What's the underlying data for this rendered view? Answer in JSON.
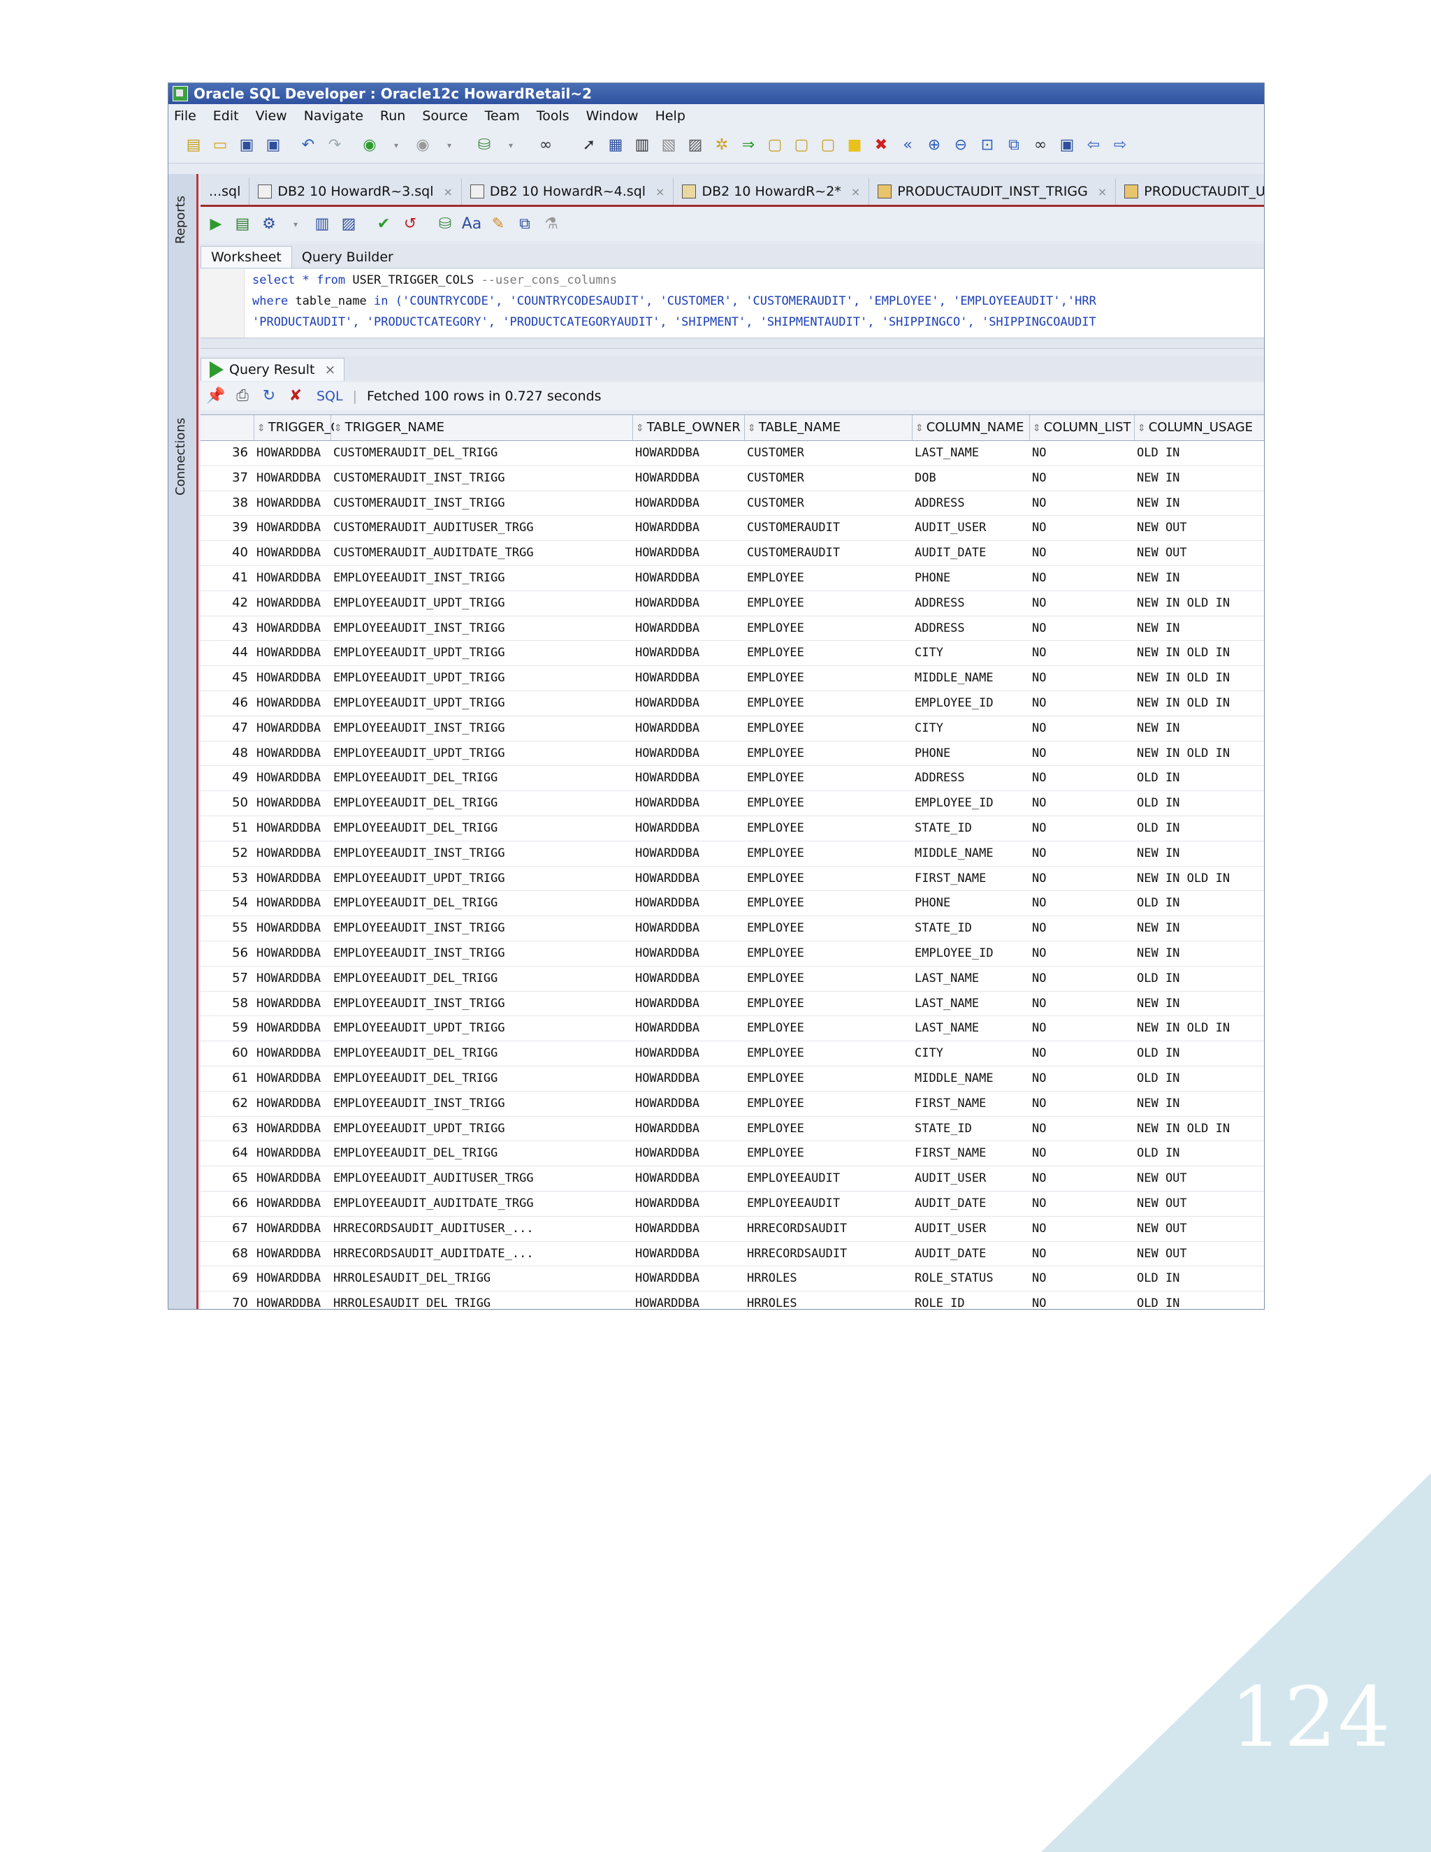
{
  "window": {
    "title": "Oracle SQL Developer : Oracle12c HowardRetail~2"
  },
  "menu": [
    "File",
    "Edit",
    "View",
    "Navigate",
    "Run",
    "Source",
    "Team",
    "Tools",
    "Window",
    "Help"
  ],
  "side_panels": [
    "Reports",
    "Connections"
  ],
  "doc_tabs": [
    {
      "label": "...sql"
    },
    {
      "label": "DB2 10 HowardR~3.sql"
    },
    {
      "label": "DB2 10 HowardR~4.sql"
    },
    {
      "label": "DB2 10 HowardR~2*"
    },
    {
      "label": "PRODUCTAUDIT_INST_TRIGG"
    },
    {
      "label": "PRODUCTAUDIT_UPDT_TRIGG"
    }
  ],
  "subtabs": {
    "worksheet": "Worksheet",
    "query_builder": "Query Builder"
  },
  "editor": {
    "line1_kw": "select * from",
    "line1_obj": "USER_TRIGGER_COLS",
    "line1_comment": "--user_cons_columns",
    "line2_kw": "where",
    "line2_plain": "table_name",
    "line2_kw2": "in",
    "line2_values": "('COUNTRYCODE', 'COUNTRYCODESAUDIT', 'CUSTOMER', 'CUSTOMERAUDIT', 'EMPLOYEE', 'EMPLOYEEAUDIT','HRR",
    "line3_values": "'PRODUCTAUDIT', 'PRODUCTCATEGORY', 'PRODUCTCATEGORYAUDIT', 'SHIPMENT', 'SHIPMENTAUDIT', 'SHIPPINGCO', 'SHIPPINGCOAUDIT"
  },
  "results": {
    "tab_label": "Query Result",
    "close": "×",
    "sql_link": "SQL",
    "status": "Fetched 100 rows in 0.727 seconds",
    "columns": [
      "TRIGGER_OWNER",
      "TRIGGER_NAME",
      "TABLE_OWNER",
      "TABLE_NAME",
      "COLUMN_NAME",
      "COLUMN_LIST",
      "COLUMN_USAGE"
    ],
    "rows": [
      [
        "36",
        "HOWARDDBA",
        "CUSTOMERAUDIT_DEL_TRIGG",
        "HOWARDDBA",
        "CUSTOMER",
        "LAST_NAME",
        "NO",
        "OLD IN"
      ],
      [
        "37",
        "HOWARDDBA",
        "CUSTOMERAUDIT_INST_TRIGG",
        "HOWARDDBA",
        "CUSTOMER",
        "DOB",
        "NO",
        "NEW IN"
      ],
      [
        "38",
        "HOWARDDBA",
        "CUSTOMERAUDIT_INST_TRIGG",
        "HOWARDDBA",
        "CUSTOMER",
        "ADDRESS",
        "NO",
        "NEW IN"
      ],
      [
        "39",
        "HOWARDDBA",
        "CUSTOMERAUDIT_AUDITUSER_TRGG",
        "HOWARDDBA",
        "CUSTOMERAUDIT",
        "AUDIT_USER",
        "NO",
        "NEW OUT"
      ],
      [
        "40",
        "HOWARDDBA",
        "CUSTOMERAUDIT_AUDITDATE_TRGG",
        "HOWARDDBA",
        "CUSTOMERAUDIT",
        "AUDIT_DATE",
        "NO",
        "NEW OUT"
      ],
      [
        "41",
        "HOWARDDBA",
        "EMPLOYEEAUDIT_INST_TRIGG",
        "HOWARDDBA",
        "EMPLOYEE",
        "PHONE",
        "NO",
        "NEW IN"
      ],
      [
        "42",
        "HOWARDDBA",
        "EMPLOYEEAUDIT_UPDT_TRIGG",
        "HOWARDDBA",
        "EMPLOYEE",
        "ADDRESS",
        "NO",
        "NEW IN OLD IN"
      ],
      [
        "43",
        "HOWARDDBA",
        "EMPLOYEEAUDIT_INST_TRIGG",
        "HOWARDDBA",
        "EMPLOYEE",
        "ADDRESS",
        "NO",
        "NEW IN"
      ],
      [
        "44",
        "HOWARDDBA",
        "EMPLOYEEAUDIT_UPDT_TRIGG",
        "HOWARDDBA",
        "EMPLOYEE",
        "CITY",
        "NO",
        "NEW IN OLD IN"
      ],
      [
        "45",
        "HOWARDDBA",
        "EMPLOYEEAUDIT_UPDT_TRIGG",
        "HOWARDDBA",
        "EMPLOYEE",
        "MIDDLE_NAME",
        "NO",
        "NEW IN OLD IN"
      ],
      [
        "46",
        "HOWARDDBA",
        "EMPLOYEEAUDIT_UPDT_TRIGG",
        "HOWARDDBA",
        "EMPLOYEE",
        "EMPLOYEE_ID",
        "NO",
        "NEW IN OLD IN"
      ],
      [
        "47",
        "HOWARDDBA",
        "EMPLOYEEAUDIT_INST_TRIGG",
        "HOWARDDBA",
        "EMPLOYEE",
        "CITY",
        "NO",
        "NEW IN"
      ],
      [
        "48",
        "HOWARDDBA",
        "EMPLOYEEAUDIT_UPDT_TRIGG",
        "HOWARDDBA",
        "EMPLOYEE",
        "PHONE",
        "NO",
        "NEW IN OLD IN"
      ],
      [
        "49",
        "HOWARDDBA",
        "EMPLOYEEAUDIT_DEL_TRIGG",
        "HOWARDDBA",
        "EMPLOYEE",
        "ADDRESS",
        "NO",
        "OLD IN"
      ],
      [
        "50",
        "HOWARDDBA",
        "EMPLOYEEAUDIT_DEL_TRIGG",
        "HOWARDDBA",
        "EMPLOYEE",
        "EMPLOYEE_ID",
        "NO",
        "OLD IN"
      ],
      [
        "51",
        "HOWARDDBA",
        "EMPLOYEEAUDIT_DEL_TRIGG",
        "HOWARDDBA",
        "EMPLOYEE",
        "STATE_ID",
        "NO",
        "OLD IN"
      ],
      [
        "52",
        "HOWARDDBA",
        "EMPLOYEEAUDIT_INST_TRIGG",
        "HOWARDDBA",
        "EMPLOYEE",
        "MIDDLE_NAME",
        "NO",
        "NEW IN"
      ],
      [
        "53",
        "HOWARDDBA",
        "EMPLOYEEAUDIT_UPDT_TRIGG",
        "HOWARDDBA",
        "EMPLOYEE",
        "FIRST_NAME",
        "NO",
        "NEW IN OLD IN"
      ],
      [
        "54",
        "HOWARDDBA",
        "EMPLOYEEAUDIT_DEL_TRIGG",
        "HOWARDDBA",
        "EMPLOYEE",
        "PHONE",
        "NO",
        "OLD IN"
      ],
      [
        "55",
        "HOWARDDBA",
        "EMPLOYEEAUDIT_INST_TRIGG",
        "HOWARDDBA",
        "EMPLOYEE",
        "STATE_ID",
        "NO",
        "NEW IN"
      ],
      [
        "56",
        "HOWARDDBA",
        "EMPLOYEEAUDIT_INST_TRIGG",
        "HOWARDDBA",
        "EMPLOYEE",
        "EMPLOYEE_ID",
        "NO",
        "NEW IN"
      ],
      [
        "57",
        "HOWARDDBA",
        "EMPLOYEEAUDIT_DEL_TRIGG",
        "HOWARDDBA",
        "EMPLOYEE",
        "LAST_NAME",
        "NO",
        "OLD IN"
      ],
      [
        "58",
        "HOWARDDBA",
        "EMPLOYEEAUDIT_INST_TRIGG",
        "HOWARDDBA",
        "EMPLOYEE",
        "LAST_NAME",
        "NO",
        "NEW IN"
      ],
      [
        "59",
        "HOWARDDBA",
        "EMPLOYEEAUDIT_UPDT_TRIGG",
        "HOWARDDBA",
        "EMPLOYEE",
        "LAST_NAME",
        "NO",
        "NEW IN OLD IN"
      ],
      [
        "60",
        "HOWARDDBA",
        "EMPLOYEEAUDIT_DEL_TRIGG",
        "HOWARDDBA",
        "EMPLOYEE",
        "CITY",
        "NO",
        "OLD IN"
      ],
      [
        "61",
        "HOWARDDBA",
        "EMPLOYEEAUDIT_DEL_TRIGG",
        "HOWARDDBA",
        "EMPLOYEE",
        "MIDDLE_NAME",
        "NO",
        "OLD IN"
      ],
      [
        "62",
        "HOWARDDBA",
        "EMPLOYEEAUDIT_INST_TRIGG",
        "HOWARDDBA",
        "EMPLOYEE",
        "FIRST_NAME",
        "NO",
        "NEW IN"
      ],
      [
        "63",
        "HOWARDDBA",
        "EMPLOYEEAUDIT_UPDT_TRIGG",
        "HOWARDDBA",
        "EMPLOYEE",
        "STATE_ID",
        "NO",
        "NEW IN OLD IN"
      ],
      [
        "64",
        "HOWARDDBA",
        "EMPLOYEEAUDIT_DEL_TRIGG",
        "HOWARDDBA",
        "EMPLOYEE",
        "FIRST_NAME",
        "NO",
        "OLD IN"
      ],
      [
        "65",
        "HOWARDDBA",
        "EMPLOYEEAUDIT_AUDITUSER_TRGG",
        "HOWARDDBA",
        "EMPLOYEEAUDIT",
        "AUDIT_USER",
        "NO",
        "NEW OUT"
      ],
      [
        "66",
        "HOWARDDBA",
        "EMPLOYEEAUDIT_AUDITDATE_TRGG",
        "HOWARDDBA",
        "EMPLOYEEAUDIT",
        "AUDIT_DATE",
        "NO",
        "NEW OUT"
      ],
      [
        "67",
        "HOWARDDBA",
        "HRRECORDSAUDIT_AUDITUSER_...",
        "HOWARDDBA",
        "HRRECORDSAUDIT",
        "AUDIT_USER",
        "NO",
        "NEW OUT"
      ],
      [
        "68",
        "HOWARDDBA",
        "HRRECORDSAUDIT_AUDITDATE_...",
        "HOWARDDBA",
        "HRRECORDSAUDIT",
        "AUDIT_DATE",
        "NO",
        "NEW OUT"
      ],
      [
        "69",
        "HOWARDDBA",
        "HRROLESAUDIT_DEL_TRIGG",
        "HOWARDDBA",
        "HRROLES",
        "ROLE_STATUS",
        "NO",
        "OLD IN"
      ],
      [
        "70",
        "HOWARDDBA",
        "HRROLESAUDIT_DEL_TRIGG",
        "HOWARDDBA",
        "HRROLES",
        "ROLE_ID",
        "NO",
        "OLD IN"
      ]
    ]
  },
  "page_number": "124",
  "colors": {
    "corner": "#d3e6ee",
    "title_bar": "#3a5fab",
    "keyword": "#1b3fb5",
    "accent_border": "#a12b2b"
  }
}
